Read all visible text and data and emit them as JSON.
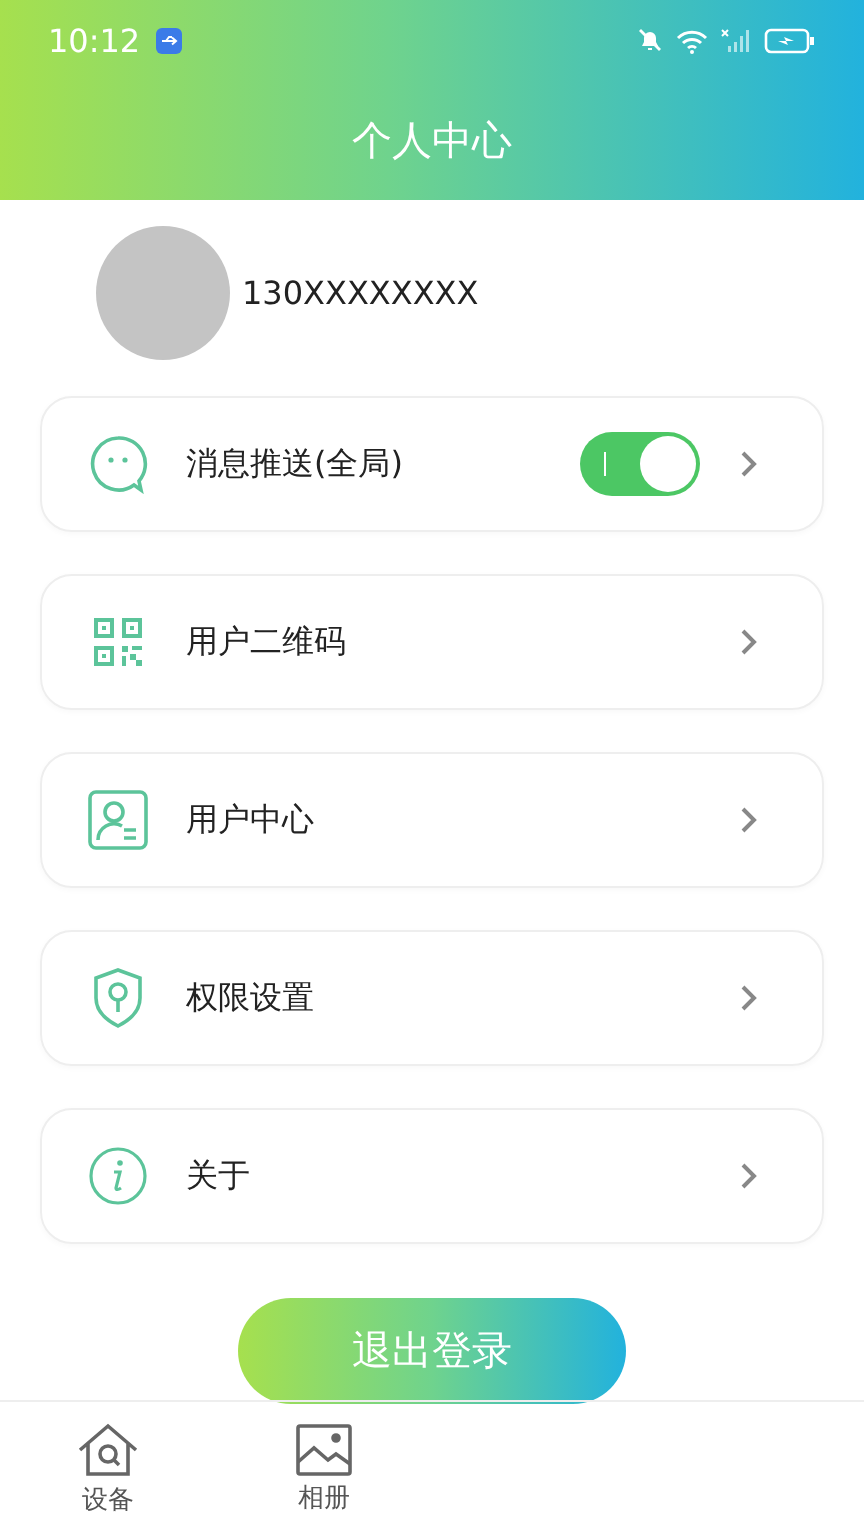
{
  "status_bar": {
    "time": "10:12"
  },
  "header": {
    "title": "个人中心"
  },
  "profile": {
    "phone": "130XXXXXXXX"
  },
  "menu": [
    {
      "label": "消息推送(全局)",
      "kind": "toggle",
      "on": true
    },
    {
      "label": "用户二维码",
      "kind": "link"
    },
    {
      "label": "用户中心",
      "kind": "link"
    },
    {
      "label": "权限设置",
      "kind": "link"
    },
    {
      "label": "关于",
      "kind": "link"
    }
  ],
  "logout_button": {
    "label": "退出登录"
  },
  "tabs": [
    {
      "label": "设备"
    },
    {
      "label": "相册"
    }
  ]
}
